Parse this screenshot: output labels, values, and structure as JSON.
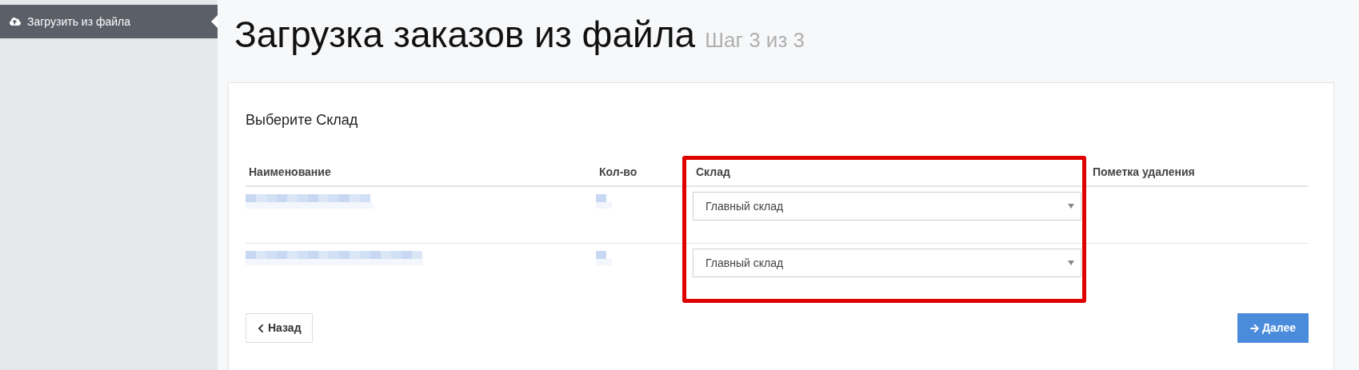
{
  "sidebar": {
    "items": [
      {
        "label": "Загрузить из файла",
        "selected": true
      }
    ]
  },
  "page": {
    "title": "Загрузка заказов из файла",
    "step": "Шаг 3 из 3"
  },
  "section_title": "Выберите Склад",
  "table": {
    "columns": [
      {
        "label": "Наименование",
        "highlighted": false
      },
      {
        "label": "Кол-во",
        "highlighted": false
      },
      {
        "label": "Склад",
        "highlighted": true
      },
      {
        "label": "Пометка удаления",
        "highlighted": false
      }
    ],
    "rows": [
      {
        "warehouse": "Главный склад"
      },
      {
        "warehouse": "Главный склад"
      }
    ]
  },
  "buttons": {
    "back": "Назад",
    "next": "Далее"
  }
}
